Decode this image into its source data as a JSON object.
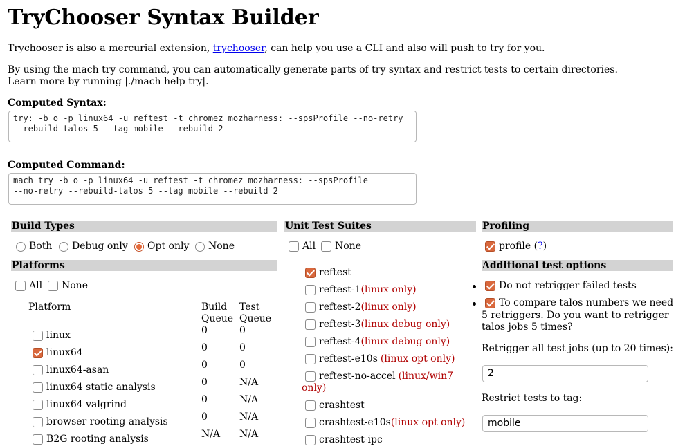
{
  "title": "TryChooser Syntax Builder",
  "intro": {
    "before_link": "Trychooser is also a mercurial extension, ",
    "link": "trychooser",
    "after_link": ", can help you use a CLI and also will push to try for you."
  },
  "mach_note": {
    "line1": "By using the mach try command, you can automatically generate parts of try syntax and restrict tests to certain directories.",
    "line2": "Learn more by running |./mach help try|."
  },
  "computed_syntax": {
    "label": "Computed Syntax:",
    "value": "try: -b o -p linux64 -u reftest -t chromez mozharness: --spsProfile --no-retry\n--rebuild-talos 5 --tag mobile --rebuild 2"
  },
  "computed_command": {
    "label": "Computed Command:",
    "value": "mach try -b o -p linux64 -u reftest -t chromez mozharness: --spsProfile\n--no-retry --rebuild-talos 5 --tag mobile --rebuild 2"
  },
  "build_types": {
    "heading": "Build Types",
    "options": [
      {
        "label": "Both",
        "selected": false
      },
      {
        "label": "Debug only",
        "selected": false
      },
      {
        "label": "Opt only",
        "selected": true
      },
      {
        "label": "None",
        "selected": false
      }
    ]
  },
  "platforms": {
    "heading": "Platforms",
    "all_label": "All",
    "none_label": "None",
    "col_platform": "Platform",
    "col_build": "Build",
    "col_build2": "Queue",
    "col_test": "Test",
    "col_test2": "Queue",
    "rows": [
      {
        "name": "linux",
        "checked": false,
        "build": "0",
        "test": "0"
      },
      {
        "name": "linux64",
        "checked": true,
        "build": "0",
        "test": "0"
      },
      {
        "name": "linux64-asan",
        "checked": false,
        "build": "0",
        "test": "0"
      },
      {
        "name": "linux64 static analysis",
        "checked": false,
        "build": "0",
        "test": "N/A"
      },
      {
        "name": "linux64 valgrind",
        "checked": false,
        "build": "0",
        "test": "N/A"
      },
      {
        "name": "browser rooting analysis",
        "checked": false,
        "build": "0",
        "test": "N/A"
      },
      {
        "name": "B2G rooting analysis",
        "checked": false,
        "build": "N/A",
        "test": "N/A"
      }
    ]
  },
  "unit_tests": {
    "heading": "Unit Test Suites",
    "all_label": "All",
    "none_label": "None",
    "items": [
      {
        "name": "reftest",
        "note": "",
        "checked": true
      },
      {
        "name": "reftest-1",
        "note": "(linux only)",
        "checked": false
      },
      {
        "name": "reftest-2",
        "note": "(linux only)",
        "checked": false
      },
      {
        "name": "reftest-3",
        "note": "(linux debug only)",
        "checked": false
      },
      {
        "name": "reftest-4",
        "note": "(linux debug only)",
        "checked": false
      },
      {
        "name": "reftest-e10s",
        "note": "(linux opt only)",
        "checked": false
      },
      {
        "name": "reftest-no-accel",
        "note": "(linux/win7",
        "note2": "only)",
        "checked": false
      },
      {
        "name": "crashtest",
        "note": "",
        "checked": false
      },
      {
        "name": "crashtest-e10s",
        "note": "(linux opt only)",
        "checked": false
      },
      {
        "name": "crashtest-ipc",
        "note": "",
        "checked": false
      }
    ]
  },
  "profiling": {
    "heading": "Profiling",
    "profile_label": "profile",
    "help_open": "(",
    "help_link": "?",
    "help_close": ")",
    "checked": true
  },
  "additional": {
    "heading": "Additional test options",
    "no_retrigger": "Do not retrigger failed tests",
    "talos_line1": "To compare talos numbers we need",
    "talos_line2": "5 retriggers. Do you want to retrigger",
    "talos_line3": "talos jobs 5 times?",
    "retrigger_label": "Retrigger all test jobs (up to 20 times):",
    "retrigger_value": "2",
    "tag_label": "Restrict tests to tag:",
    "tag_value": "mobile"
  },
  "colors": {
    "section_bar": "#d3d3d3",
    "checked": "#d9683d",
    "note_red": "#b00000",
    "link": "#0000ee"
  }
}
